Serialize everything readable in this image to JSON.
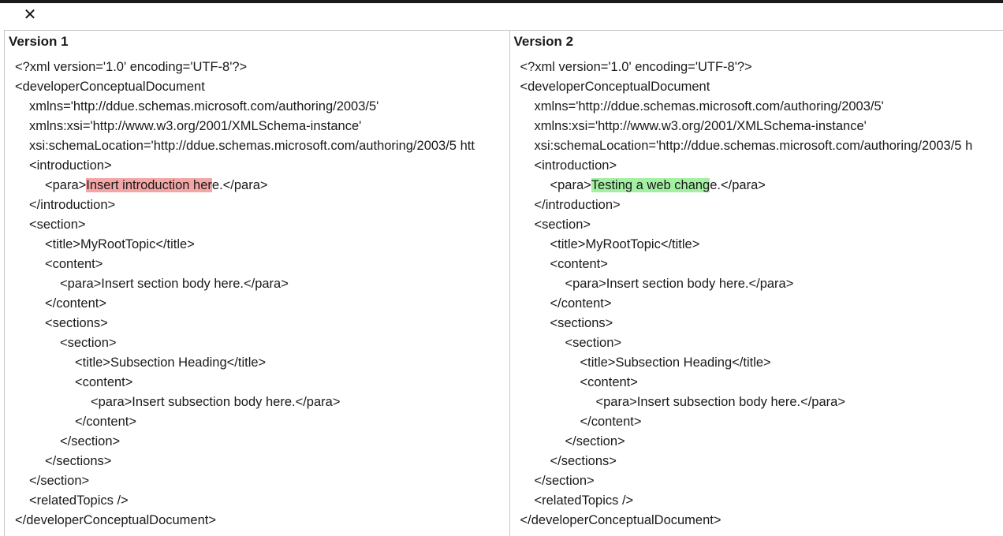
{
  "toolbar": {
    "close_icon": "close-icon",
    "close_glyph": "✕"
  },
  "left": {
    "title": "Version 1",
    "lines": [
      "<?xml version='1.0' encoding='UTF-8'?>",
      "<developerConceptualDocument",
      "xmlns='http://ddue.schemas.microsoft.com/authoring/2003/5'",
      "xmlns:xsi='http://www.w3.org/2001/XMLSchema-instance'",
      "xsi:schemaLocation='http://ddue.schemas.microsoft.com/authoring/2003/5 htt",
      "<introduction>",
      {
        "before": "<para>",
        "highlight": "Insert introduction her",
        "after": "e.</para>"
      },
      "</introduction>",
      "<section>",
      "<title>MyRootTopic</title>",
      "<content>",
      "<para>Insert section body here.</para>",
      "</content>",
      "<sections>",
      "<section>",
      "<title>Subsection Heading</title>",
      "<content>",
      "<para>Insert subsection body here.</para>",
      "</content>",
      "</section>",
      "</sections>",
      "</section>",
      "<relatedTopics />",
      "</developerConceptualDocument>"
    ]
  },
  "right": {
    "title": "Version 2",
    "lines": [
      "<?xml version='1.0' encoding='UTF-8'?>",
      "<developerConceptualDocument",
      "xmlns='http://ddue.schemas.microsoft.com/authoring/2003/5'",
      "xmlns:xsi='http://www.w3.org/2001/XMLSchema-instance'",
      "xsi:schemaLocation='http://ddue.schemas.microsoft.com/authoring/2003/5 h",
      "<introduction>",
      {
        "before": "<para>",
        "highlight": "Testing a web chang",
        "after": "e.</para>"
      },
      "</introduction>",
      "<section>",
      "<title>MyRootTopic</title>",
      "<content>",
      "<para>Insert section body here.</para>",
      "</content>",
      "<sections>",
      "<section>",
      "<title>Subsection Heading</title>",
      "<content>",
      "<para>Insert subsection body here.</para>",
      "</content>",
      "</section>",
      "</sections>",
      "</section>",
      "<relatedTopics />",
      "</developerConceptualDocument>"
    ]
  },
  "colors": {
    "deleted_highlight": "#f4a6a6",
    "inserted_highlight": "#a3f0a3"
  }
}
